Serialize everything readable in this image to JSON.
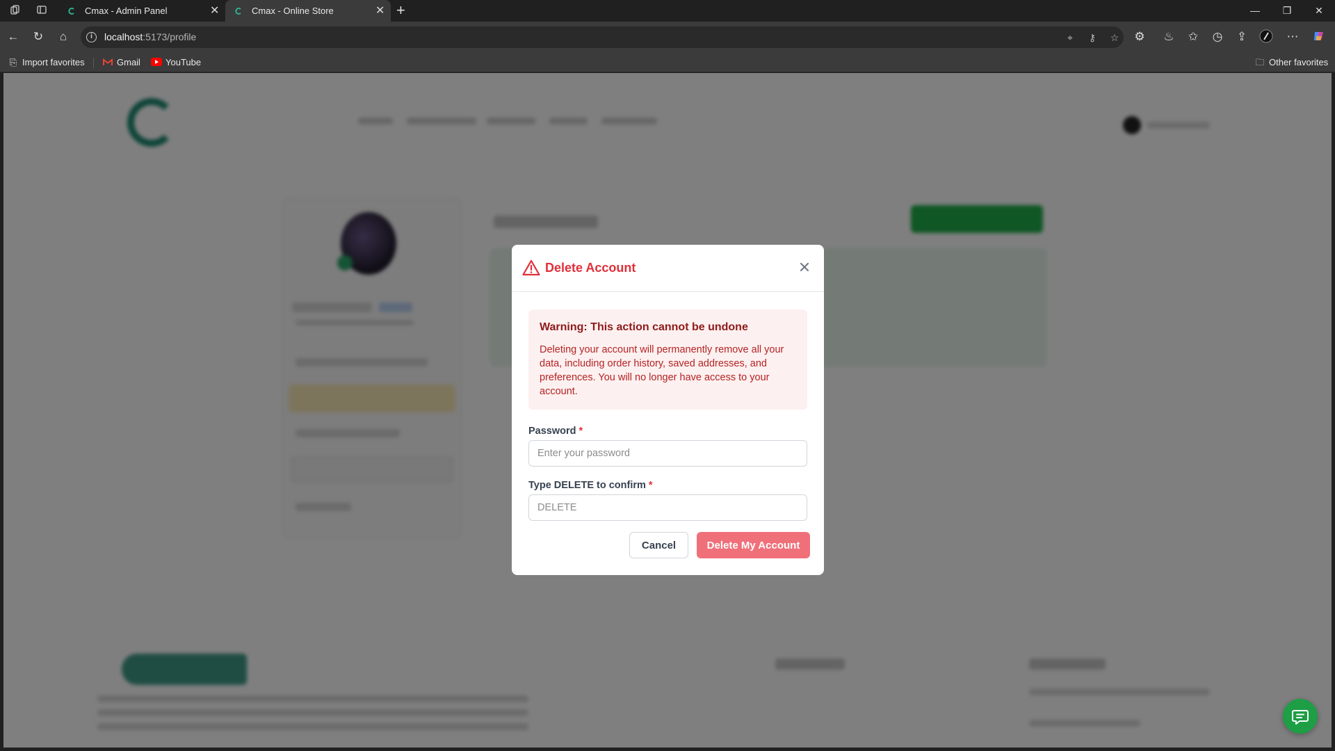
{
  "browser": {
    "tabs": [
      {
        "title": "Cmax - Admin Panel",
        "active": false
      },
      {
        "title": "Cmax - Online Store",
        "active": true
      }
    ],
    "url_host": "localhost",
    "url_rest": ":5173/profile",
    "bookmarks": [
      {
        "label": "Import favorites",
        "icon": "import-icon"
      },
      {
        "label": "Gmail",
        "icon": "gmail-icon"
      },
      {
        "label": "YouTube",
        "icon": "youtube-icon"
      }
    ],
    "other_favorites": "Other favorites"
  },
  "modal": {
    "title": "Delete Account",
    "warning_title": "Warning: This action cannot be undone",
    "warning_text": "Deleting your account will permanently remove all your data, including order history, saved addresses, and preferences. You will no longer have access to your account.",
    "password_label": "Password",
    "password_placeholder": "Enter your password",
    "confirm_label": "Type DELETE to confirm",
    "confirm_placeholder": "DELETE",
    "required_mark": "*",
    "cancel_label": "Cancel",
    "delete_label": "Delete My Account"
  },
  "colors": {
    "danger": "#e0303a",
    "delete_button": "#f0707a",
    "alert_bg": "#fdf0f0",
    "brand_green": "#1e9e45"
  }
}
